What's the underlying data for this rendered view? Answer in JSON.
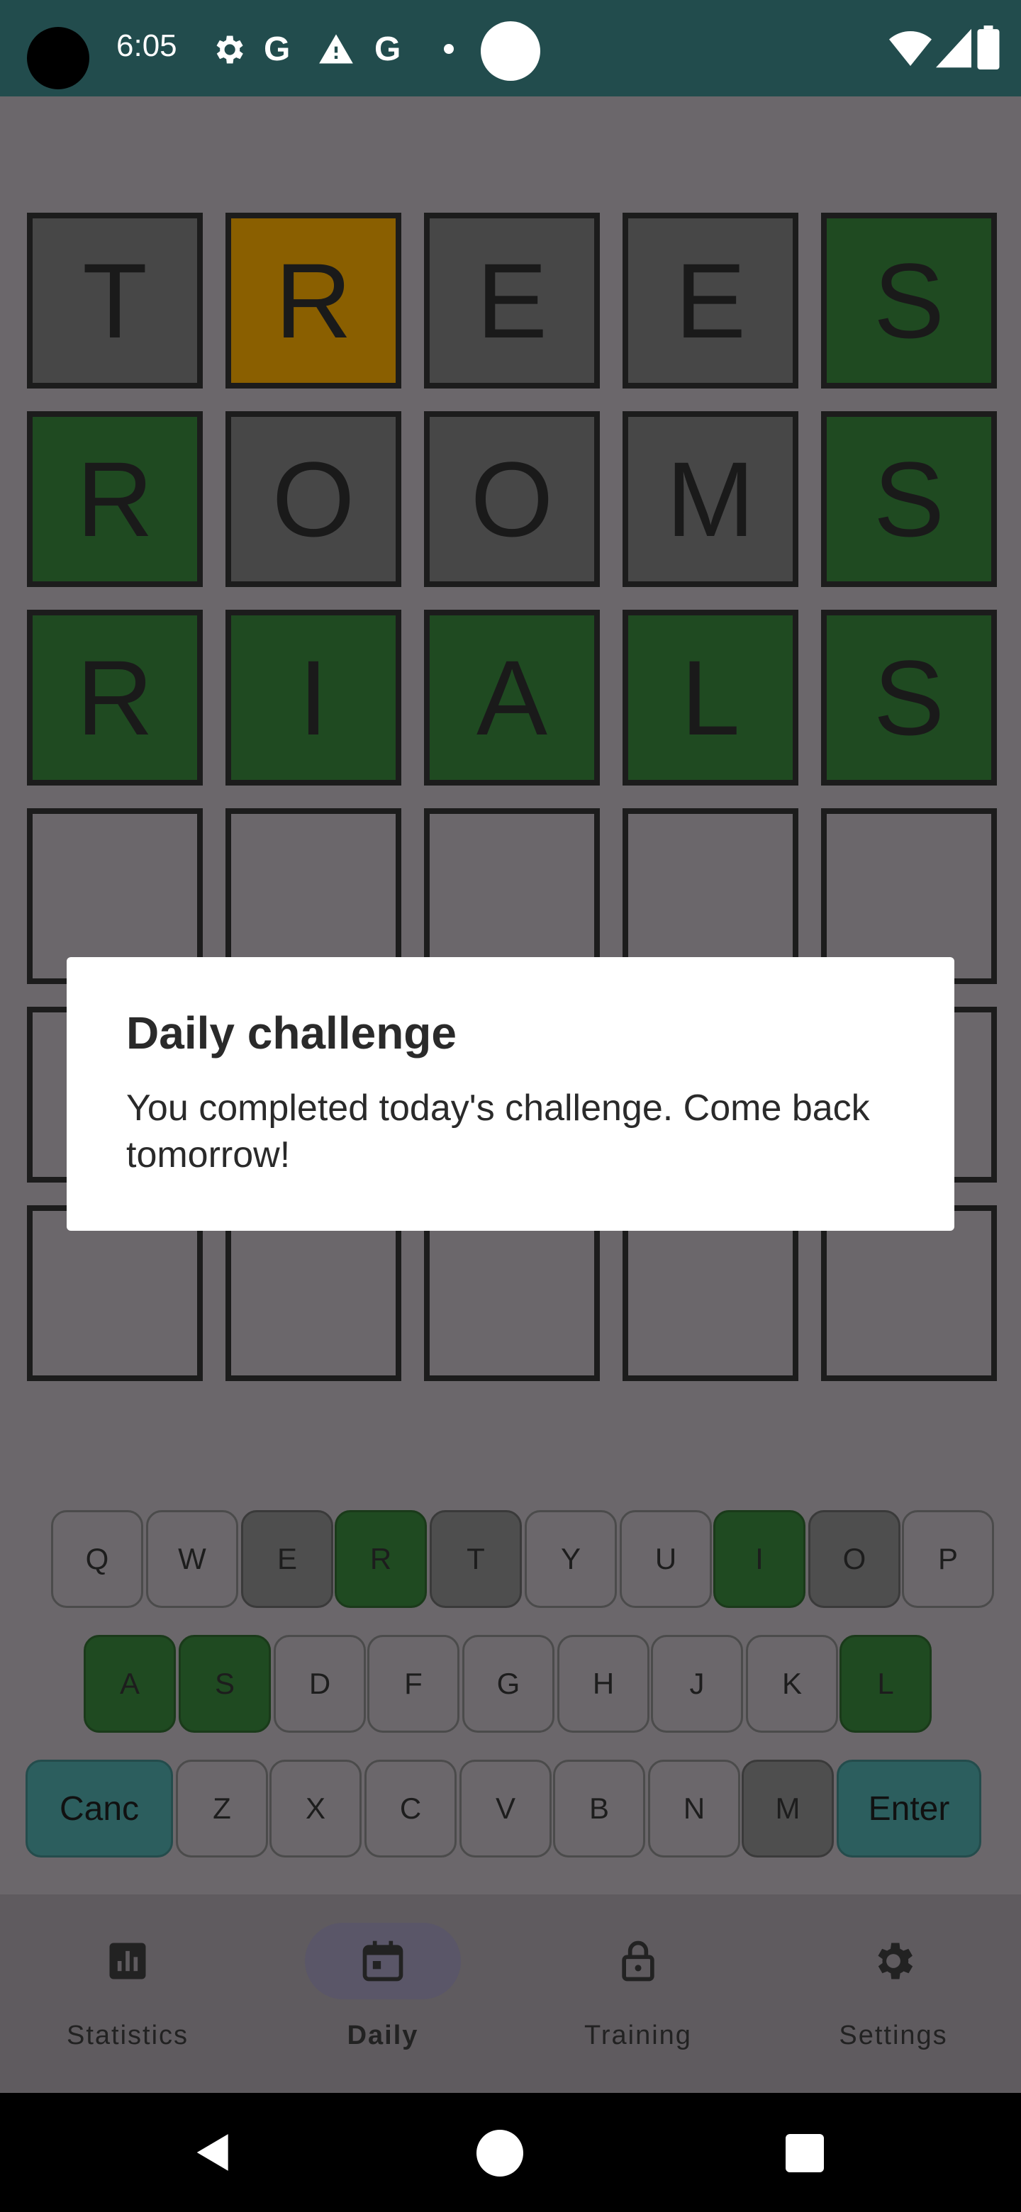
{
  "status_bar": {
    "time": "6:05",
    "icons": [
      "gear-icon",
      "google-g-icon",
      "warning-icon",
      "google-g-icon",
      "dot-icon",
      "circle-icon",
      "wifi-icon",
      "signal-icon",
      "battery-icon"
    ]
  },
  "board": {
    "rows": [
      [
        {
          "letter": "T",
          "state": "gray"
        },
        {
          "letter": "R",
          "state": "yellow"
        },
        {
          "letter": "E",
          "state": "gray"
        },
        {
          "letter": "E",
          "state": "gray"
        },
        {
          "letter": "S",
          "state": "green"
        }
      ],
      [
        {
          "letter": "R",
          "state": "green"
        },
        {
          "letter": "O",
          "state": "gray"
        },
        {
          "letter": "O",
          "state": "gray"
        },
        {
          "letter": "M",
          "state": "gray"
        },
        {
          "letter": "S",
          "state": "green"
        }
      ],
      [
        {
          "letter": "R",
          "state": "green"
        },
        {
          "letter": "I",
          "state": "green"
        },
        {
          "letter": "A",
          "state": "green"
        },
        {
          "letter": "L",
          "state": "green"
        },
        {
          "letter": "S",
          "state": "green"
        }
      ],
      [
        {
          "letter": "",
          "state": "empty"
        },
        {
          "letter": "",
          "state": "empty"
        },
        {
          "letter": "",
          "state": "empty"
        },
        {
          "letter": "",
          "state": "empty"
        },
        {
          "letter": "",
          "state": "empty"
        }
      ],
      [
        {
          "letter": "",
          "state": "empty"
        },
        {
          "letter": "",
          "state": "empty"
        },
        {
          "letter": "",
          "state": "empty"
        },
        {
          "letter": "",
          "state": "empty"
        },
        {
          "letter": "",
          "state": "empty"
        }
      ],
      [
        {
          "letter": "",
          "state": "empty"
        },
        {
          "letter": "",
          "state": "empty"
        },
        {
          "letter": "",
          "state": "empty"
        },
        {
          "letter": "",
          "state": "empty"
        },
        {
          "letter": "",
          "state": "empty"
        }
      ]
    ]
  },
  "keyboard": {
    "row1": [
      {
        "label": "Q",
        "state": "default"
      },
      {
        "label": "W",
        "state": "default"
      },
      {
        "label": "E",
        "state": "dark"
      },
      {
        "label": "R",
        "state": "green"
      },
      {
        "label": "T",
        "state": "dark"
      },
      {
        "label": "Y",
        "state": "default"
      },
      {
        "label": "U",
        "state": "default"
      },
      {
        "label": "I",
        "state": "green"
      },
      {
        "label": "O",
        "state": "dark"
      },
      {
        "label": "P",
        "state": "default"
      }
    ],
    "row2": [
      {
        "label": "A",
        "state": "green"
      },
      {
        "label": "S",
        "state": "green"
      },
      {
        "label": "D",
        "state": "default"
      },
      {
        "label": "F",
        "state": "default"
      },
      {
        "label": "G",
        "state": "default"
      },
      {
        "label": "H",
        "state": "default"
      },
      {
        "label": "J",
        "state": "default"
      },
      {
        "label": "K",
        "state": "default"
      },
      {
        "label": "L",
        "state": "green"
      }
    ],
    "row3": [
      {
        "label": "Canc",
        "state": "teal"
      },
      {
        "label": "Z",
        "state": "default"
      },
      {
        "label": "X",
        "state": "default"
      },
      {
        "label": "C",
        "state": "default"
      },
      {
        "label": "V",
        "state": "default"
      },
      {
        "label": "B",
        "state": "default"
      },
      {
        "label": "N",
        "state": "default"
      },
      {
        "label": "M",
        "state": "dark"
      },
      {
        "label": "Enter",
        "state": "teal"
      }
    ]
  },
  "bottom_nav": {
    "items": [
      {
        "label": "Statistics",
        "icon": "bar-chart-icon",
        "active": false
      },
      {
        "label": "Daily",
        "icon": "calendar-icon",
        "active": true
      },
      {
        "label": "Training",
        "icon": "lock-icon",
        "active": false
      },
      {
        "label": "Settings",
        "icon": "gear-icon",
        "active": false
      }
    ]
  },
  "dialog": {
    "title": "Daily challenge",
    "message": "You completed today's challenge. Come back tomorrow!"
  },
  "colors": {
    "status_bar": "#224c4d",
    "tile_green": "#1f4a21",
    "tile_yellow": "#8a5f00",
    "tile_gray": "#474747",
    "key_teal": "#2c5e5e"
  }
}
